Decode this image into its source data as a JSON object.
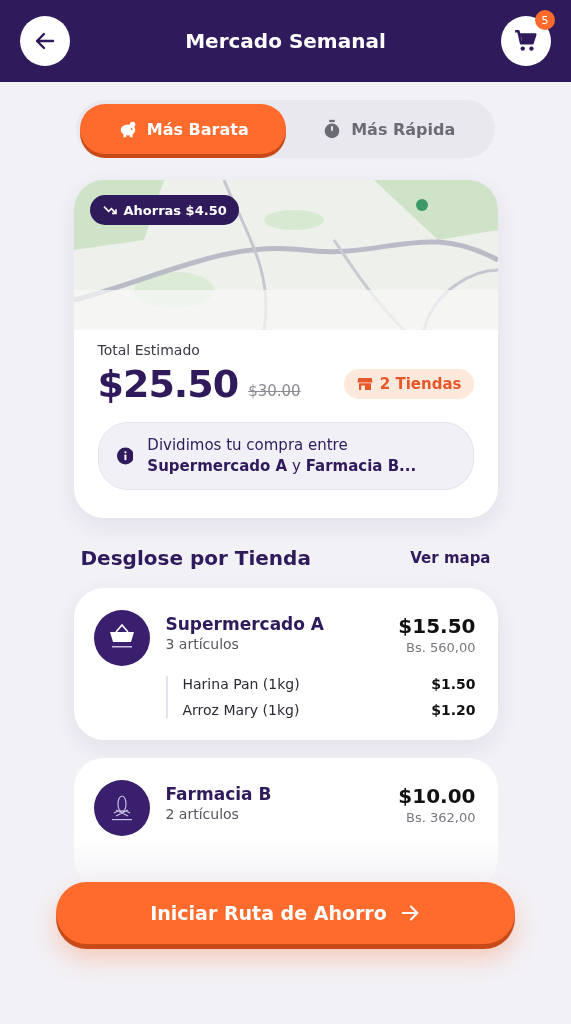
{
  "header": {
    "title": "Mercado Semanal",
    "cart_count": "5"
  },
  "tabs": [
    {
      "label": "Más Barata",
      "kind": "piggy",
      "selected": true
    },
    {
      "label": "Más Rápida",
      "kind": "timer",
      "selected": false
    }
  ],
  "summary": {
    "savings_badge": "Ahorras $4.50",
    "total_label": "Total Estimado",
    "total": "$25.50",
    "old_total": "$30.00",
    "stores_badge": "2 Tiendas",
    "info": "Dividimos tu compra entre **Supermercado A** y **Farmacia B...**"
  },
  "breakdown": {
    "title": "Desglose por Tienda",
    "link": "Ver mapa"
  },
  "stores": [
    {
      "name": "Supermercado A",
      "kind": "basket",
      "count": "3 artículos",
      "price": "$15.50",
      "local_price": "Bs. 560,00",
      "items": [
        {
          "name": "Harina Pan (1kg)",
          "price": "$1.50"
        },
        {
          "name": "Arroz Mary (1kg)",
          "price": "$1.20"
        }
      ]
    },
    {
      "name": "Farmacia B",
      "kind": "flower",
      "count": "2 artículos",
      "price": "$10.00",
      "local_price": "Bs. 362,00"
    }
  ],
  "action": {
    "label": "Iniciar Ruta de Ahorro"
  }
}
